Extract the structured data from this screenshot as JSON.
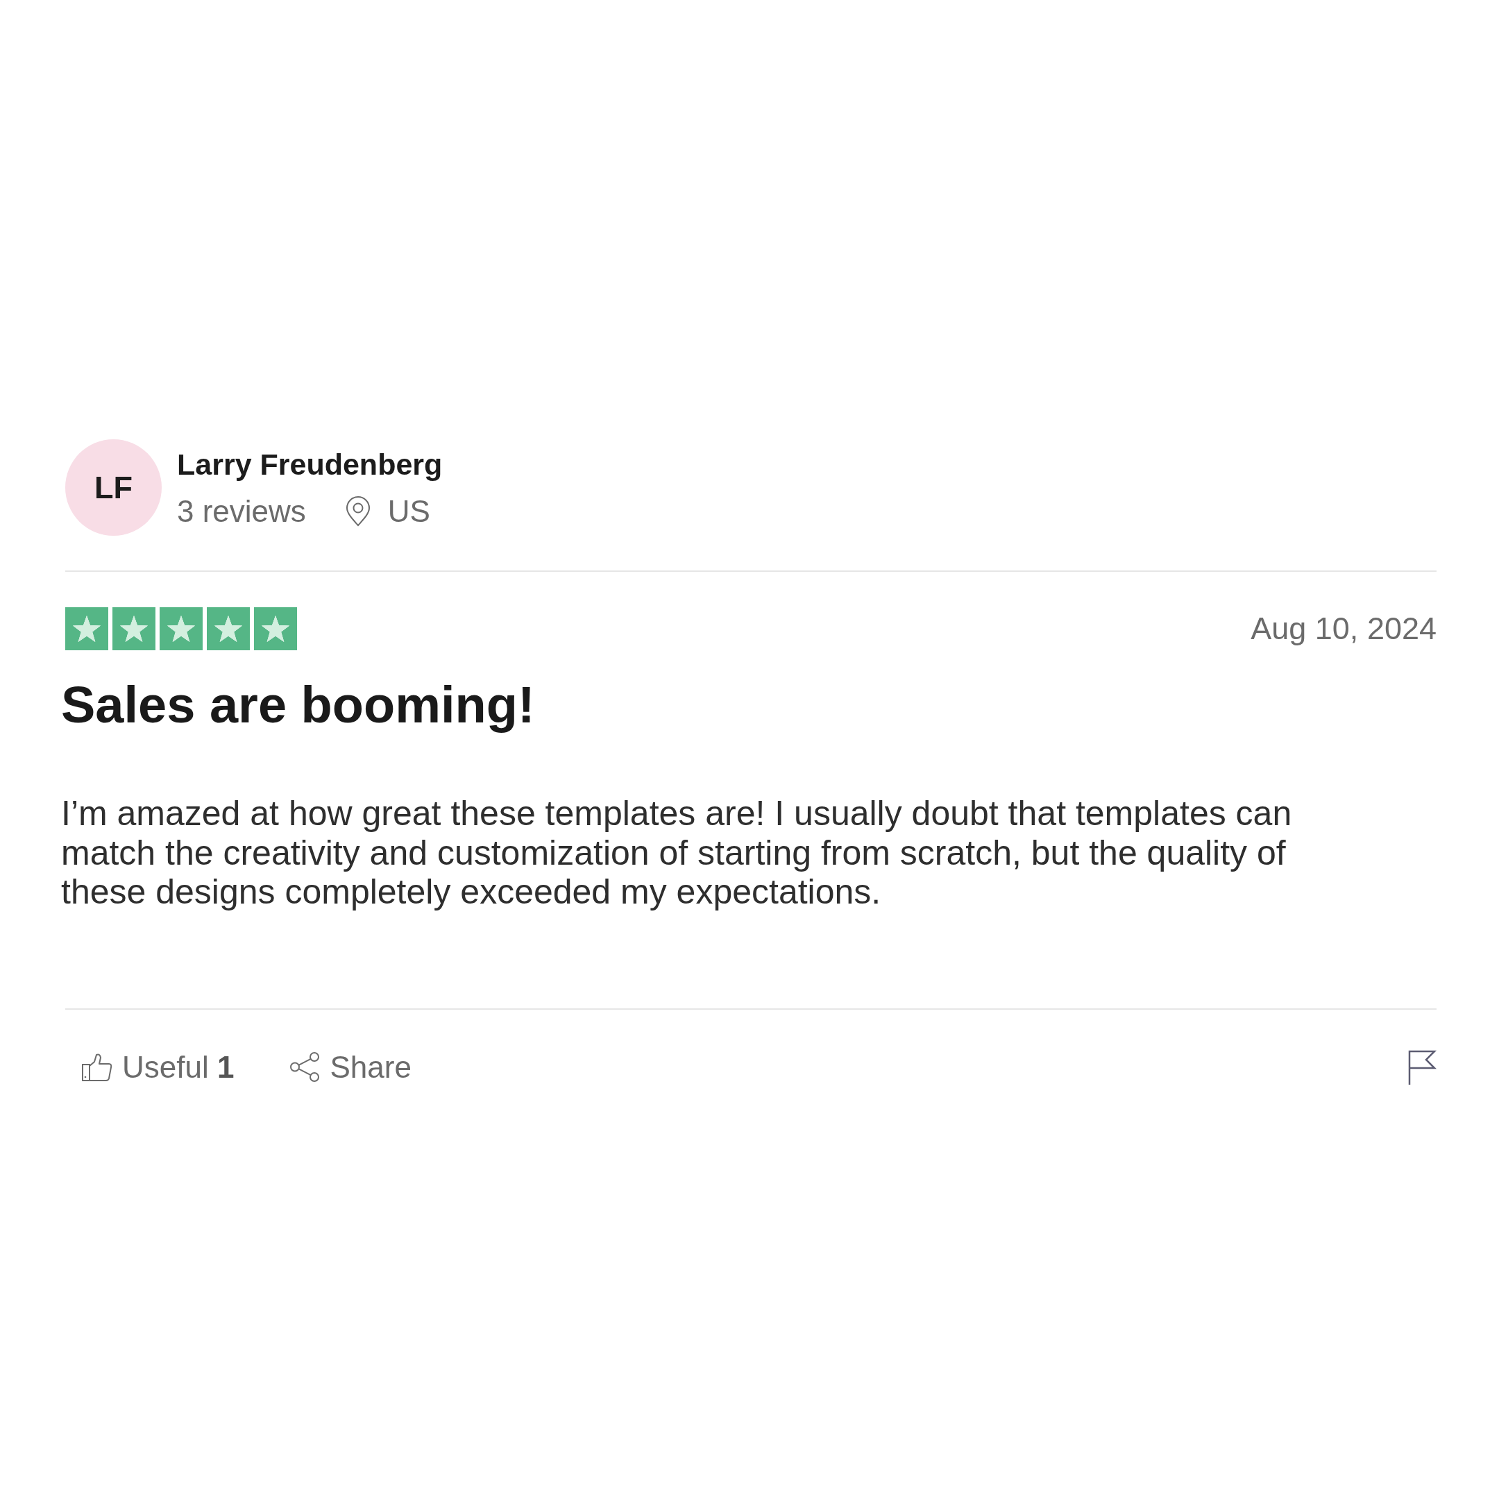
{
  "reviewer": {
    "initials": "LF",
    "name": "Larry Freudenberg",
    "review_count": "3 reviews",
    "location": "US"
  },
  "review": {
    "stars": 5,
    "date": "Aug 10, 2024",
    "title": "Sales are booming!",
    "body": "I’m amazed at how great these templates are! I usually doubt that templates can match the creativity and customization of starting from scratch, but the quality of these designs completely exceeded my expectations."
  },
  "actions": {
    "useful": "Useful **1**",
    "share": "Share"
  }
}
